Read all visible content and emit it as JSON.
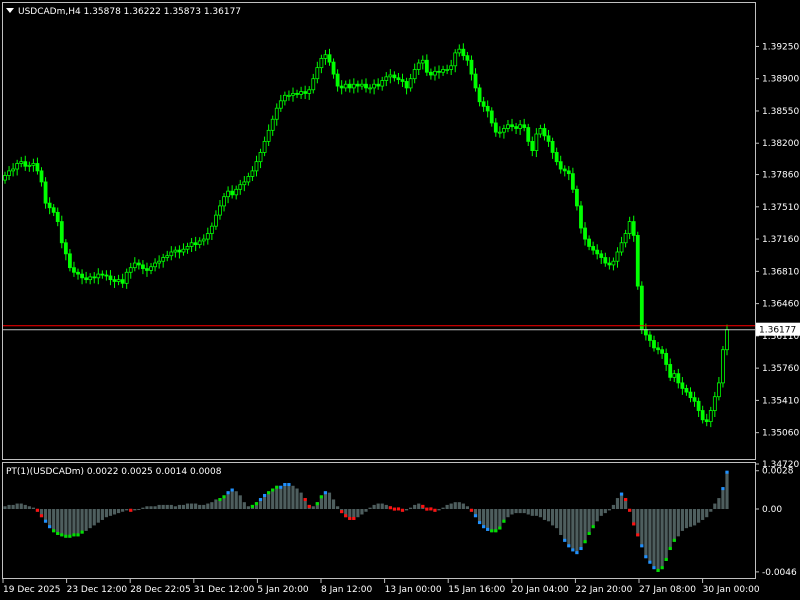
{
  "window": {
    "symbol_header": "USDCADm,H4  1.35878 1.36222 1.35873 1.36177",
    "indicator_header": "PT(1)(USDCADm) 0.0022 0.0025 0.0014 0.0008"
  },
  "colors": {
    "background": "#000000",
    "frame": "#c0c0c0",
    "candle_up": "#00ff00",
    "candle_down": "#00ff00",
    "bid_line": "#ff0000",
    "price_label_bg": "#ffffff",
    "price_label_text": "#000000",
    "hist_gray": "#4e5e5e",
    "hist_green": "#00e000",
    "hist_blue": "#1e90ff",
    "hist_red": "#ff1010"
  },
  "chart_data": [
    {
      "type": "candlestick",
      "title": "USDCADm,H4  1.35878 1.36222 1.35873 1.36177",
      "y_ticks": [
        "1.39250",
        "1.38900",
        "1.38550",
        "1.38200",
        "1.37860",
        "1.37510",
        "1.37160",
        "1.36810",
        "1.36460",
        "1.36110",
        "1.35760",
        "1.35410",
        "1.35060",
        "1.34720"
      ],
      "ylim": [
        1.3472,
        1.3945
      ],
      "current_price_label": "1.36177",
      "current_price": 1.36177,
      "grid": false,
      "x_ticks": [
        "19 Dec 2025",
        "23 Dec 12:00",
        "28 Dec 22:05",
        "31 Dec 12:00",
        "5 Jan 20:00",
        "8 Jan 12:00",
        "13 Jan 00:00",
        "15 Jan 16:00",
        "20 Jan 04:00",
        "22 Jan 20:00",
        "27 Jan 08:00",
        "30 Jan 00:00"
      ],
      "close_series": [
        1.3785,
        1.379,
        1.3792,
        1.3798,
        1.38,
        1.3795,
        1.3796,
        1.3798,
        1.379,
        1.3778,
        1.3755,
        1.375,
        1.3745,
        1.3735,
        1.3712,
        1.37,
        1.3685,
        1.368,
        1.3678,
        1.3674,
        1.3672,
        1.3675,
        1.3674,
        1.3678,
        1.3677,
        1.3676,
        1.3672,
        1.367,
        1.3672,
        1.3668,
        1.368,
        1.3685,
        1.369,
        1.3688,
        1.3684,
        1.3682,
        1.3686,
        1.369,
        1.3692,
        1.3696,
        1.3698,
        1.3702,
        1.3704,
        1.3702,
        1.3705,
        1.3708,
        1.3712,
        1.371,
        1.3714,
        1.3716,
        1.3722,
        1.373,
        1.3742,
        1.3752,
        1.3762,
        1.3768,
        1.3764,
        1.377,
        1.3775,
        1.3778,
        1.3784,
        1.379,
        1.38,
        1.381,
        1.3822,
        1.3834,
        1.3846,
        1.3858,
        1.3866,
        1.3872,
        1.3872,
        1.3874,
        1.3873,
        1.3876,
        1.3874,
        1.3878,
        1.389,
        1.3902,
        1.3912,
        1.3916,
        1.3908,
        1.3895,
        1.3882,
        1.388,
        1.3884,
        1.388,
        1.3884,
        1.3882,
        1.3884,
        1.388,
        1.388,
        1.3884,
        1.3882,
        1.3888,
        1.3892,
        1.3894,
        1.3891,
        1.3889,
        1.3887,
        1.388,
        1.389,
        1.39,
        1.3907,
        1.391,
        1.3897,
        1.3894,
        1.3898,
        1.3897,
        1.39,
        1.39,
        1.3904,
        1.3918,
        1.3922,
        1.3915,
        1.391,
        1.3895,
        1.388,
        1.3865,
        1.386,
        1.3855,
        1.3842,
        1.3832,
        1.3832,
        1.3836,
        1.384,
        1.3838,
        1.3836,
        1.384,
        1.3837,
        1.3822,
        1.3812,
        1.383,
        1.3836,
        1.3828,
        1.3822,
        1.381,
        1.38,
        1.3792,
        1.379,
        1.3787,
        1.377,
        1.3752,
        1.3728,
        1.3716,
        1.3708,
        1.3704,
        1.37,
        1.3696,
        1.369,
        1.3688,
        1.3692,
        1.3702,
        1.3712,
        1.3722,
        1.3735,
        1.372,
        1.3665,
        1.3618,
        1.3612,
        1.3606,
        1.3598,
        1.3596,
        1.3592,
        1.358,
        1.3566,
        1.357,
        1.356,
        1.3554,
        1.355,
        1.3544,
        1.354,
        1.353,
        1.352,
        1.3518,
        1.353,
        1.3545,
        1.356,
        1.3596,
        1.3618
      ]
    },
    {
      "type": "histogram",
      "title": "PT(1)(USDCADm) 0.0022 0.0025 0.0014 0.0008",
      "y_ticks": [
        "0.0028",
        "0.00",
        "-0.0046"
      ],
      "ylim": [
        -0.0049,
        0.003
      ],
      "values": [
        0.0002,
        0.0003,
        0.0003,
        0.0004,
        0.0004,
        0.0003,
        0.0002,
        0.0001,
        -0.0002,
        -0.0006,
        -0.001,
        -0.0014,
        -0.0017,
        -0.0019,
        -0.002,
        -0.0021,
        -0.0021,
        -0.002,
        -0.002,
        -0.0018,
        -0.0016,
        -0.0014,
        -0.0012,
        -0.001,
        -0.0008,
        -0.0006,
        -0.0005,
        -0.0004,
        -0.0003,
        -0.0002,
        -0.0001,
        -0.0002,
        -0.0001,
        0.0,
        0.0001,
        0.0002,
        0.0002,
        0.0002,
        0.0003,
        0.0003,
        0.0003,
        0.0003,
        0.0002,
        0.0003,
        0.0003,
        0.0004,
        0.0004,
        0.0004,
        0.0003,
        0.0003,
        0.0004,
        0.0005,
        0.0007,
        0.0008,
        0.001,
        0.0013,
        0.0015,
        0.0013,
        0.001,
        0.0005,
        0.0002,
        0.0003,
        0.0005,
        0.0008,
        0.0011,
        0.0013,
        0.0015,
        0.0017,
        0.0017,
        0.0019,
        0.0019,
        0.0017,
        0.0015,
        0.0012,
        0.0008,
        0.0003,
        0.0002,
        0.0005,
        0.001,
        0.0013,
        0.0012,
        0.0007,
        0.0002,
        -0.0003,
        -0.0006,
        -0.0008,
        -0.0008,
        -0.0006,
        -0.0004,
        -0.0002,
        0.0001,
        0.0003,
        0.0004,
        0.0004,
        0.0003,
        0.0002,
        0.0001,
        -0.0001,
        -0.0002,
        -0.0001,
        0.0001,
        0.0003,
        0.0004,
        0.0003,
        0.0001,
        -0.0001,
        -0.0002,
        -0.0001,
        0.0001,
        0.0003,
        0.0004,
        0.0005,
        0.0005,
        0.0004,
        0.0002,
        -0.0002,
        -0.0006,
        -0.0011,
        -0.0014,
        -0.0016,
        -0.0017,
        -0.0017,
        -0.0015,
        -0.001,
        -0.0006,
        -0.0004,
        -0.0003,
        -0.0003,
        -0.0003,
        -0.0004,
        -0.0005,
        -0.0005,
        -0.0006,
        -0.0008,
        -0.0009,
        -0.0012,
        -0.0014,
        -0.0019,
        -0.0024,
        -0.0028,
        -0.0031,
        -0.0033,
        -0.003,
        -0.0025,
        -0.0019,
        -0.0014,
        -0.0009,
        -0.0005,
        -0.0003,
        -0.0001,
        0.0003,
        0.0008,
        0.0012,
        0.0008,
        -0.0002,
        -0.0012,
        -0.002,
        -0.0028,
        -0.0036,
        -0.004,
        -0.0044,
        -0.0046,
        -0.0044,
        -0.0038,
        -0.003,
        -0.0024,
        -0.002,
        -0.0016,
        -0.0014,
        -0.0013,
        -0.0012,
        -0.001,
        -0.0008,
        -0.0006,
        -0.0002,
        0.0004,
        0.0008,
        0.0016,
        0.0028
      ],
      "colors": [
        "gray",
        "gray",
        "gray",
        "gray",
        "gray",
        "gray",
        "gray",
        "gray",
        "red",
        "red",
        "blue",
        "blue",
        "green",
        "green",
        "green",
        "green",
        "green",
        "green",
        "green",
        "green",
        "gray",
        "gray",
        "gray",
        "gray",
        "gray",
        "gray",
        "gray",
        "gray",
        "gray",
        "gray",
        "gray",
        "red",
        "gray",
        "gray",
        "gray",
        "gray",
        "gray",
        "gray",
        "gray",
        "gray",
        "gray",
        "gray",
        "gray",
        "gray",
        "gray",
        "gray",
        "gray",
        "gray",
        "gray",
        "gray",
        "gray",
        "gray",
        "gray",
        "green",
        "green",
        "blue",
        "blue",
        "gray",
        "gray",
        "gray",
        "gray",
        "green",
        "green",
        "blue",
        "blue",
        "green",
        "green",
        "green",
        "blue",
        "blue",
        "blue",
        "gray",
        "gray",
        "gray",
        "red",
        "red",
        "gray",
        "green",
        "green",
        "blue",
        "gray",
        "gray",
        "gray",
        "red",
        "red",
        "red",
        "red",
        "gray",
        "gray",
        "gray",
        "gray",
        "gray",
        "gray",
        "gray",
        "gray",
        "red",
        "red",
        "red",
        "red",
        "gray",
        "gray",
        "gray",
        "gray",
        "red",
        "red",
        "red",
        "red",
        "gray",
        "gray",
        "gray",
        "gray",
        "gray",
        "gray",
        "gray",
        "gray",
        "red",
        "blue",
        "blue",
        "blue",
        "blue",
        "green",
        "green",
        "green",
        "green",
        "gray",
        "gray",
        "gray",
        "gray",
        "gray",
        "gray",
        "gray",
        "gray",
        "gray",
        "gray",
        "gray",
        "gray",
        "gray",
        "gray",
        "blue",
        "blue",
        "blue",
        "blue",
        "blue",
        "green",
        "green",
        "green",
        "gray",
        "gray",
        "gray",
        "gray",
        "gray",
        "gray",
        "blue",
        "red",
        "red",
        "red",
        "red",
        "blue",
        "blue",
        "blue",
        "blue",
        "green",
        "green",
        "green",
        "green",
        "green",
        "gray",
        "gray",
        "gray",
        "gray",
        "gray",
        "gray",
        "gray",
        "gray",
        "gray",
        "gray",
        "gray",
        "blue",
        "blue"
      ]
    }
  ]
}
